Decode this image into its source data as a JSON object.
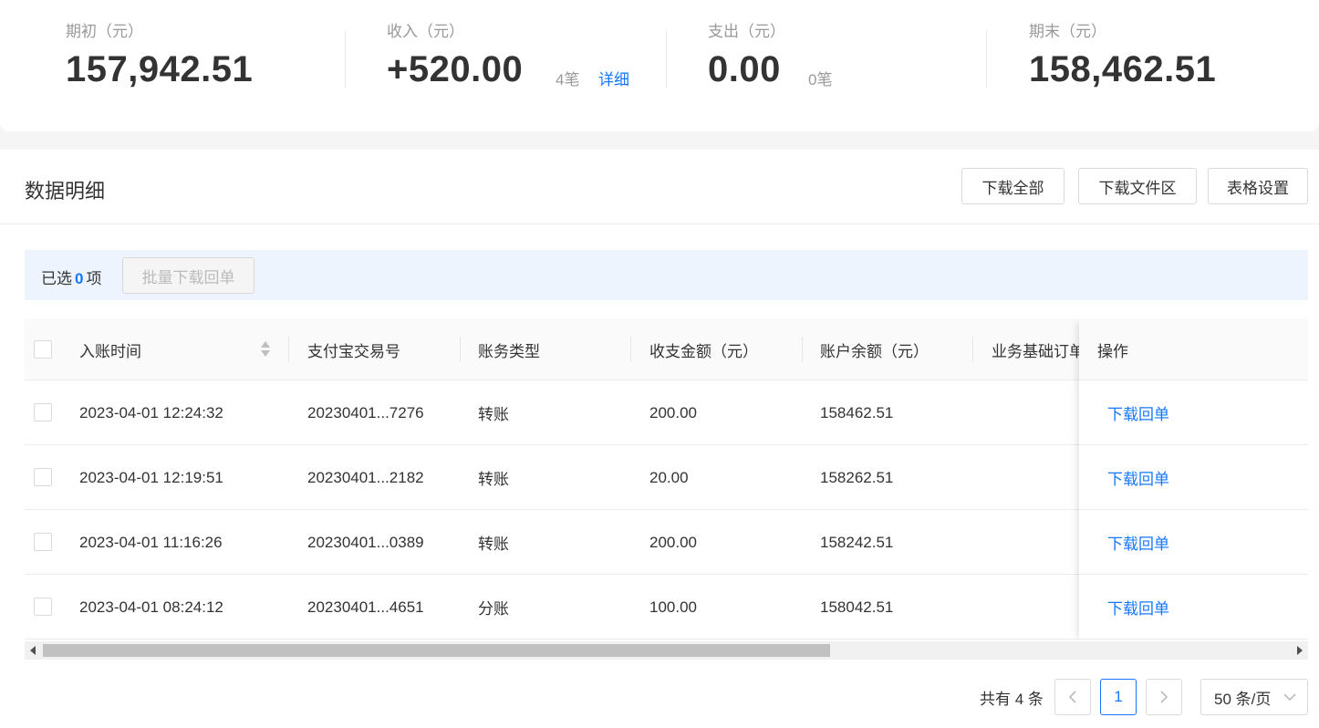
{
  "summary": {
    "opening": {
      "label": "期初（元）",
      "value": "157,942.51"
    },
    "income": {
      "label": "收入（元）",
      "value": "+520.00",
      "count": "4笔",
      "detail": "详细"
    },
    "expense": {
      "label": "支出（元）",
      "value": "0.00",
      "count": "0笔"
    },
    "closing": {
      "label": "期末（元）",
      "value": "158,462.51"
    }
  },
  "panel": {
    "title": "数据明细",
    "buttons": {
      "download_all": "下载全部",
      "download_files": "下载文件区",
      "table_settings": "表格设置"
    }
  },
  "selection": {
    "prefix": "已选",
    "count": "0",
    "suffix": "项",
    "batch_button": "批量下载回单"
  },
  "table": {
    "headers": {
      "time": "入账时间",
      "trade_no": "支付宝交易号",
      "type": "账务类型",
      "amount": "收支金额（元）",
      "balance": "账户余额（元）",
      "order": "业务基础订单",
      "action": "操作"
    },
    "rows": [
      {
        "time": "2023-04-01 12:24:32",
        "trade_no": "20230401...7276",
        "type": "转账",
        "amount": "200.00",
        "balance": "158462.51",
        "action": "下载回单"
      },
      {
        "time": "2023-04-01 12:19:51",
        "trade_no": "20230401...2182",
        "type": "转账",
        "amount": "20.00",
        "balance": "158262.51",
        "action": "下载回单"
      },
      {
        "time": "2023-04-01 11:16:26",
        "trade_no": "20230401...0389",
        "type": "转账",
        "amount": "200.00",
        "balance": "158242.51",
        "action": "下载回单"
      },
      {
        "time": "2023-04-01 08:24:12",
        "trade_no": "20230401...4651",
        "type": "分账",
        "amount": "100.00",
        "balance": "158042.51",
        "action": "下载回单"
      }
    ]
  },
  "pagination": {
    "total": "共有 4 条",
    "current_page": "1",
    "page_size": "50 条/页"
  },
  "icons": {
    "sort": "sort-icon",
    "prev": "chevron-left-icon",
    "next": "chevron-right-icon",
    "dropdown": "chevron-down-icon"
  },
  "colors": {
    "accent": "#1677ff",
    "selection_bar": "#eef4fd",
    "muted": "#999999"
  }
}
